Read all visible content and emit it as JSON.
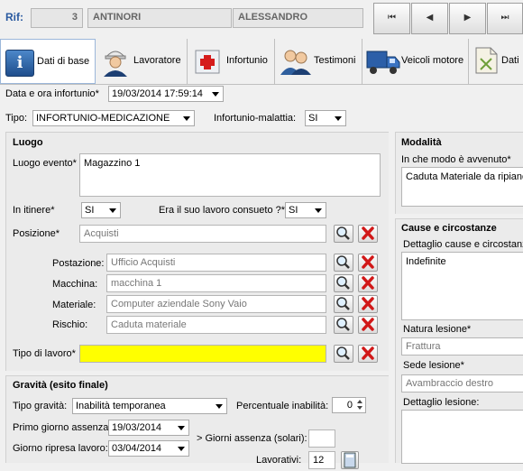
{
  "header": {
    "rif_label": "Rif:",
    "rif_number": "3",
    "surname": "ANTINORI",
    "name": "ALESSANDRO"
  },
  "nav": {
    "first": "⏮",
    "prev": "◀",
    "next": "▶",
    "last": "⏭"
  },
  "tabs": [
    {
      "label": "Dati di base",
      "icon": "info-icon"
    },
    {
      "label": "Lavoratore",
      "icon": "worker-icon"
    },
    {
      "label": "Infortunio",
      "icon": "first-aid-icon"
    },
    {
      "label": "Testimoni",
      "icon": "people-icon"
    },
    {
      "label": "Veicoli motore",
      "icon": "truck-icon"
    },
    {
      "label": "Dati",
      "icon": "document-icon"
    }
  ],
  "form": {
    "data_ora_label": "Data e ora infortunio*",
    "data_ora_value": "19/03/2014 17:59:14",
    "tipo_label": "Tipo:",
    "tipo_value": "INFORTUNIO-MEDICAZIONE",
    "infortunio_malattia_label": "Infortunio-malattia:",
    "infortunio_malattia_value": "SI"
  },
  "luogo": {
    "title": "Luogo",
    "evento_label": "Luogo evento*",
    "evento_value": "Magazzino 1",
    "itinere_label": "In itinere*",
    "itinere_value": "SI",
    "consueto_label": "Era il suo lavoro consueto ?*",
    "consueto_value": "SI",
    "posizione_label": "Posizione*",
    "posizione_value": "Acquisti",
    "postazione_label": "Postazione:",
    "postazione_value": "Ufficio Acquisti",
    "macchina_label": "Macchina:",
    "macchina_value": "macchina 1",
    "materiale_label": "Materiale:",
    "materiale_value": "Computer aziendale  Sony Vaio",
    "rischio_label": "Rischio:",
    "rischio_value": "Caduta materiale",
    "tipo_lavoro_label": "Tipo di lavoro*",
    "tipo_lavoro_value": ""
  },
  "gravita": {
    "title": "Gravità (esito finale)",
    "tipo_label": "Tipo gravità:",
    "tipo_value": "Inabilità temporanea",
    "percentuale_label": "Percentuale inabilità:",
    "percentuale_value": "0",
    "primo_giorno_label": "Primo giorno assenza:",
    "primo_giorno_value": "19/03/2014",
    "ripresa_label": "Giorno ripresa lavoro:",
    "ripresa_value": "03/04/2014",
    "giorni_solari_label": "> Giorni assenza (solari):",
    "giorni_solari_value": "",
    "lavorativi_label": "Lavorativi:",
    "lavorativi_value": "12"
  },
  "modalita": {
    "title": "Modalità",
    "come_label": "In che modo è avvenuto*",
    "come_value": "Caduta Materiale da ripiano"
  },
  "cause": {
    "title": "Cause e circostanze",
    "dettaglio_label": "Dettaglio cause e circostanze",
    "dettaglio_value": "Indefinite",
    "natura_label": "Natura lesione*",
    "natura_value": "Frattura",
    "sede_label": "Sede lesione*",
    "sede_value": "Avambraccio destro",
    "dettaglio_lesione_label": "Dettaglio lesione:"
  },
  "colors": {
    "required_highlight": "#ffff00",
    "delete_red": "#d11818"
  }
}
